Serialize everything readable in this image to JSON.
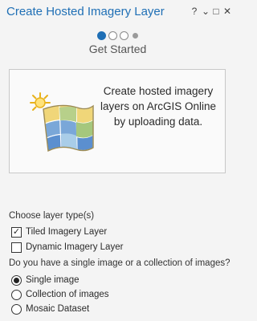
{
  "window": {
    "title": "Create Hosted Imagery Layer",
    "controls": [
      "?",
      "⌄",
      "□",
      "✕"
    ]
  },
  "wizard": {
    "step_title": "Get Started",
    "steps": [
      {
        "state": "active"
      },
      {
        "state": "inactive"
      },
      {
        "state": "inactive"
      },
      {
        "state": "inactive-small"
      }
    ]
  },
  "intro_card": {
    "icon": "imagery-layer-icon",
    "text": "Create hosted imagery layers on ArcGIS Online by uploading data."
  },
  "layer_type": {
    "label": "Choose layer type(s)",
    "options": [
      {
        "label": "Tiled Imagery Layer",
        "checked": true
      },
      {
        "label": "Dynamic Imagery Layer",
        "checked": false
      }
    ]
  },
  "image_source": {
    "label": "Do you have a single image or a collection of images?",
    "options": [
      {
        "label": "Single image",
        "selected": true
      },
      {
        "label": "Collection of images",
        "selected": false
      },
      {
        "label": "Mosaic Dataset",
        "selected": false
      }
    ]
  },
  "colors": {
    "accent": "#1f6fb5",
    "background": "#f4f4f4"
  }
}
